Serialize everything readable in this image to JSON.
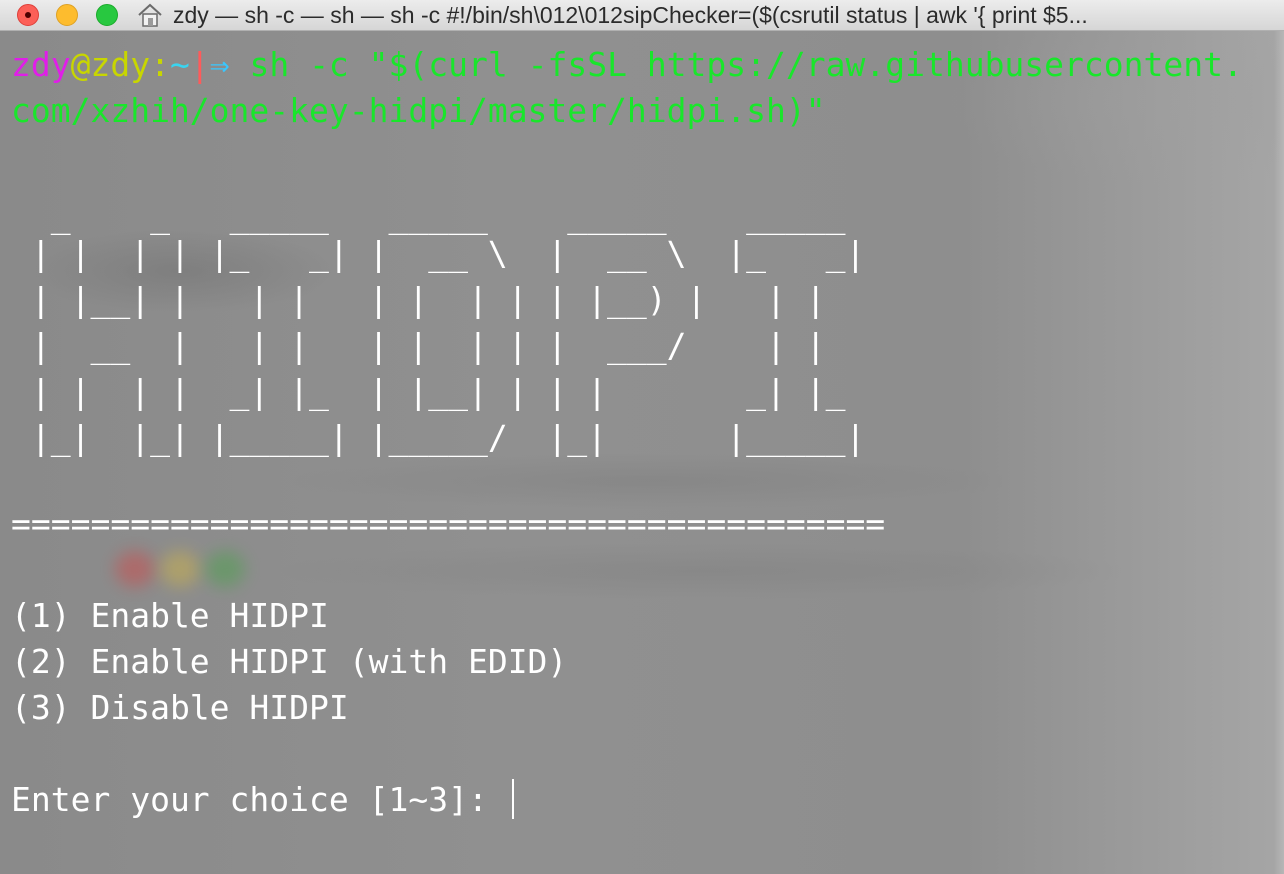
{
  "window": {
    "title": "zdy — sh -c  — sh — sh -c #!/bin/sh\\012\\012sipChecker=($(csrutil status | awk '{ print $5..."
  },
  "terminal": {
    "prompt": {
      "user": "zdy",
      "at": "@",
      "host": "zdy",
      "colon": ":",
      "path": "~",
      "bar": "|",
      "arrow": "⇒",
      "command_line1": " sh -c \"$(curl -fsSL https://raw.githubusercontent.",
      "command_line2": "com/xzhih/one-key-hidpi/master/hidpi.sh)\""
    },
    "banner": [
      "  _    _   _____   _____    _____    _____",
      " | |  | | |_   _| |  __ \\  |  __ \\  |_   _|",
      " | |__| |   | |   | |  | | | |__) |   | |",
      " |  __  |   | |   | |  | | |  ___/    | |",
      " | |  | |  _| |_  | |__| | | |       _| |_",
      " |_|  |_| |_____| |_____/  |_|      |_____|"
    ],
    "separator": "============================================",
    "options": [
      "(1) Enable HIDPI",
      "(2) Enable HIDPI (with EDID)",
      "(3) Disable HIDPI"
    ],
    "input_prompt": "Enter your choice [1~3]: "
  },
  "colors": {
    "command": "#19e62b",
    "user": "#e01ee8",
    "host": "#c8d600",
    "path": "#39d4f0",
    "output": "#ffffff",
    "background": "#8c8c8c"
  },
  "icons": {
    "title_icon": "home-icon"
  }
}
